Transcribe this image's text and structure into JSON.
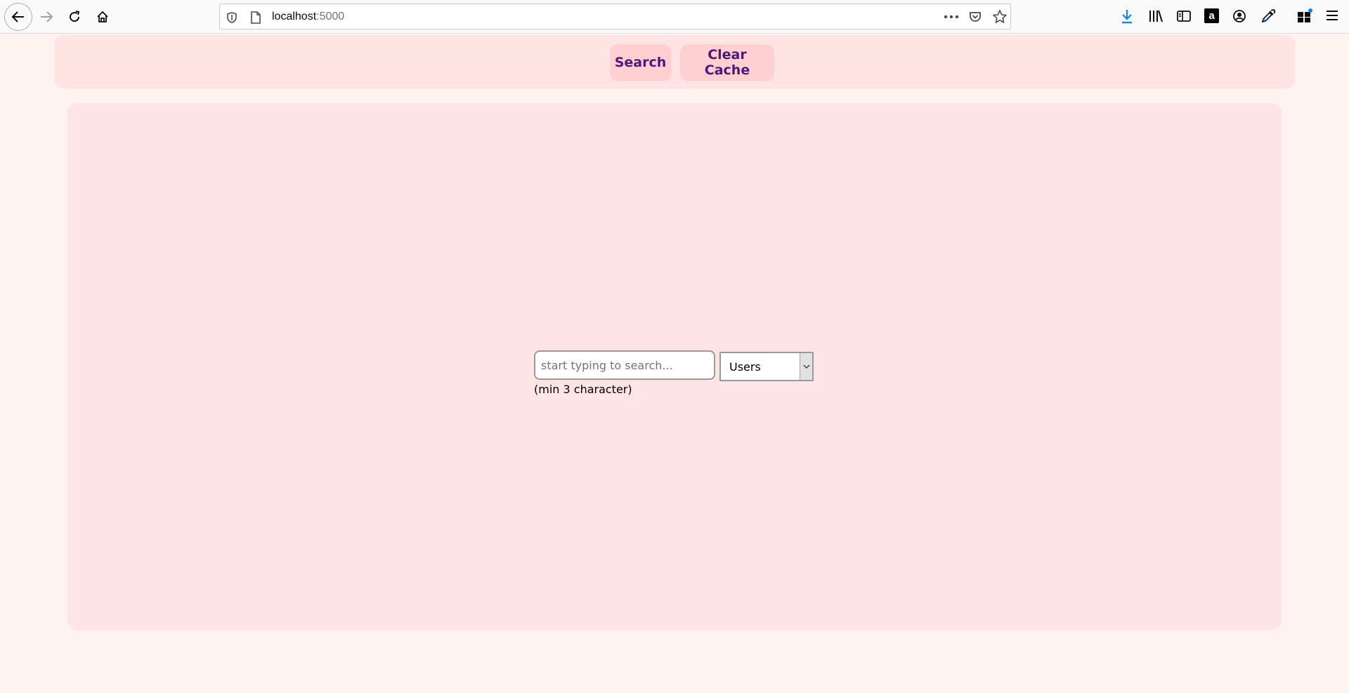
{
  "browser": {
    "url_host": "localhost",
    "url_port": ":5000",
    "icons": {
      "back": "back-arrow-icon",
      "forward": "forward-arrow-icon",
      "reload": "reload-icon",
      "home": "home-icon",
      "tracking": "shield-icon",
      "page": "page-icon",
      "more": "more-dots-icon",
      "pocket": "pocket-icon",
      "bookmark": "star-icon",
      "downloads": "download-icon",
      "library": "library-icon",
      "sidebar": "sidebar-icon",
      "amazon": "amazon-icon",
      "account": "account-icon",
      "eyedropper": "eyedropper-icon",
      "extensions": "extensions-icon",
      "menu": "hamburger-menu-icon"
    }
  },
  "nav": {
    "search_label": "Search",
    "clear_cache_label": "Clear Cache"
  },
  "search": {
    "placeholder": "start typing to search...",
    "value": "",
    "hint": "(min 3 character)",
    "type_selected": "Users"
  },
  "colors": {
    "page_bg": "#fff3f2",
    "panel_bg": "#fee4e4",
    "button_bg": "#ffcfd1",
    "button_text": "#4b1a7f",
    "download_accent": "#0a84ff"
  }
}
